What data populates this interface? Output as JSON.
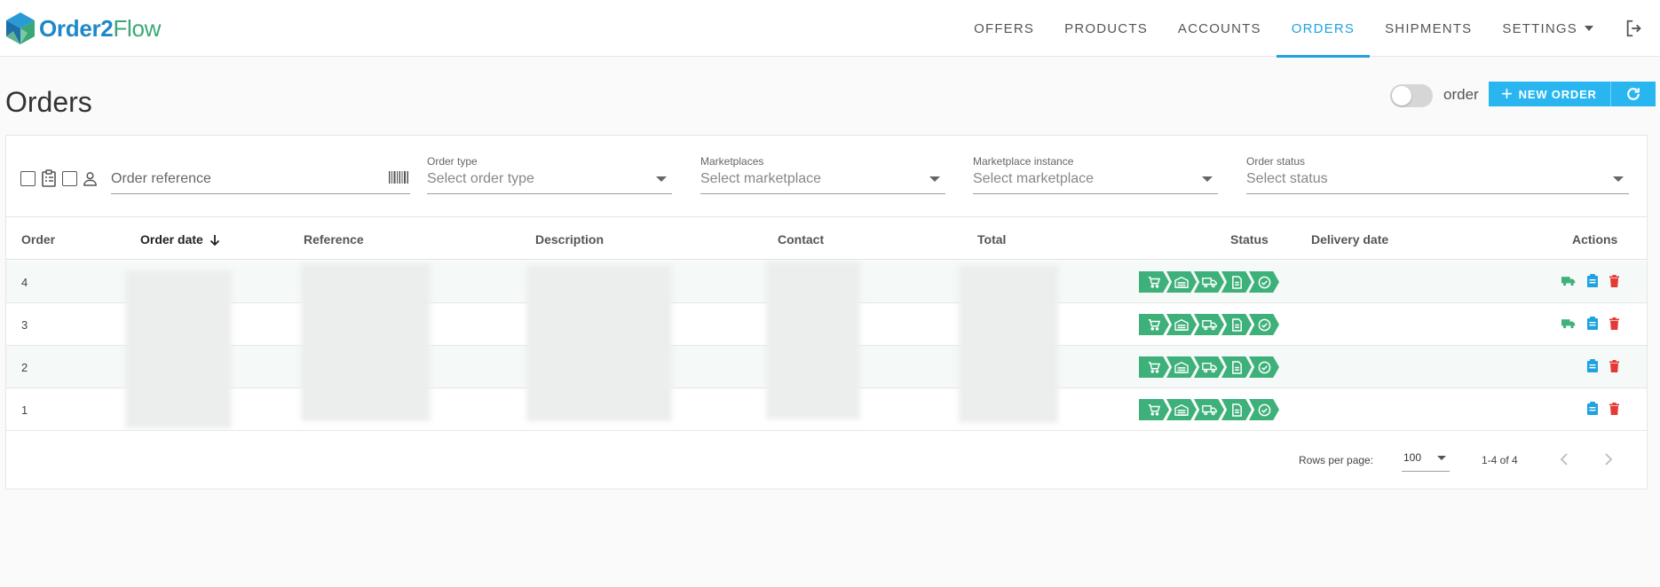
{
  "app": {
    "logo_part1": "Order2",
    "logo_part2": "Flow"
  },
  "nav": {
    "items": [
      {
        "label": "OFFERS"
      },
      {
        "label": "PRODUCTS"
      },
      {
        "label": "ACCOUNTS"
      },
      {
        "label": "ORDERS",
        "active": true
      },
      {
        "label": "SHIPMENTS"
      },
      {
        "label": "SETTINGS",
        "dropdown": true
      }
    ],
    "logout_icon": "logout-icon"
  },
  "page": {
    "title": "Orders",
    "toggle_label": "order",
    "toggle_on": false,
    "new_order_label": "NEW ORDER",
    "refresh_icon": "refresh-icon"
  },
  "filters": {
    "order_reference": {
      "placeholder": "Order reference"
    },
    "order_type": {
      "label": "Order type",
      "placeholder": "Select order type"
    },
    "marketplaces": {
      "label": "Marketplaces",
      "placeholder": "Select marketplace"
    },
    "marketplace_instance": {
      "label": "Marketplace instance",
      "placeholder": "Select marketplace"
    },
    "order_status": {
      "label": "Order status",
      "placeholder": "Select status"
    }
  },
  "table": {
    "headers": {
      "order": "Order",
      "order_date": "Order date",
      "reference": "Reference",
      "description": "Description",
      "contact": "Contact",
      "total": "Total",
      "status": "Status",
      "delivery_date": "Delivery date",
      "actions": "Actions"
    },
    "sort": {
      "column": "order_date",
      "direction": "descending"
    },
    "rows": [
      {
        "order": "4",
        "actions": [
          "shipping-icon",
          "clipboard-icon",
          "delete-icon"
        ]
      },
      {
        "order": "3",
        "actions": [
          "shipping-icon",
          "clipboard-icon",
          "delete-icon"
        ]
      },
      {
        "order": "2",
        "actions": [
          "clipboard-icon",
          "delete-icon"
        ]
      },
      {
        "order": "1",
        "actions": [
          "clipboard-icon",
          "delete-icon"
        ]
      }
    ],
    "status_steps": [
      "cart-icon",
      "warehouse-icon",
      "truck-icon",
      "document-icon",
      "check-circle-icon"
    ]
  },
  "pagination": {
    "rows_per_page_label": "Rows per page:",
    "rows_per_page": "100",
    "range": "1-4 of 4"
  },
  "colors": {
    "accent": "#1fa3e0",
    "button": "#29b6f0",
    "status_green": "#3eb07a",
    "action_green": "#3eb07a",
    "action_blue": "#1fa3e0",
    "action_red": "#e53935"
  }
}
